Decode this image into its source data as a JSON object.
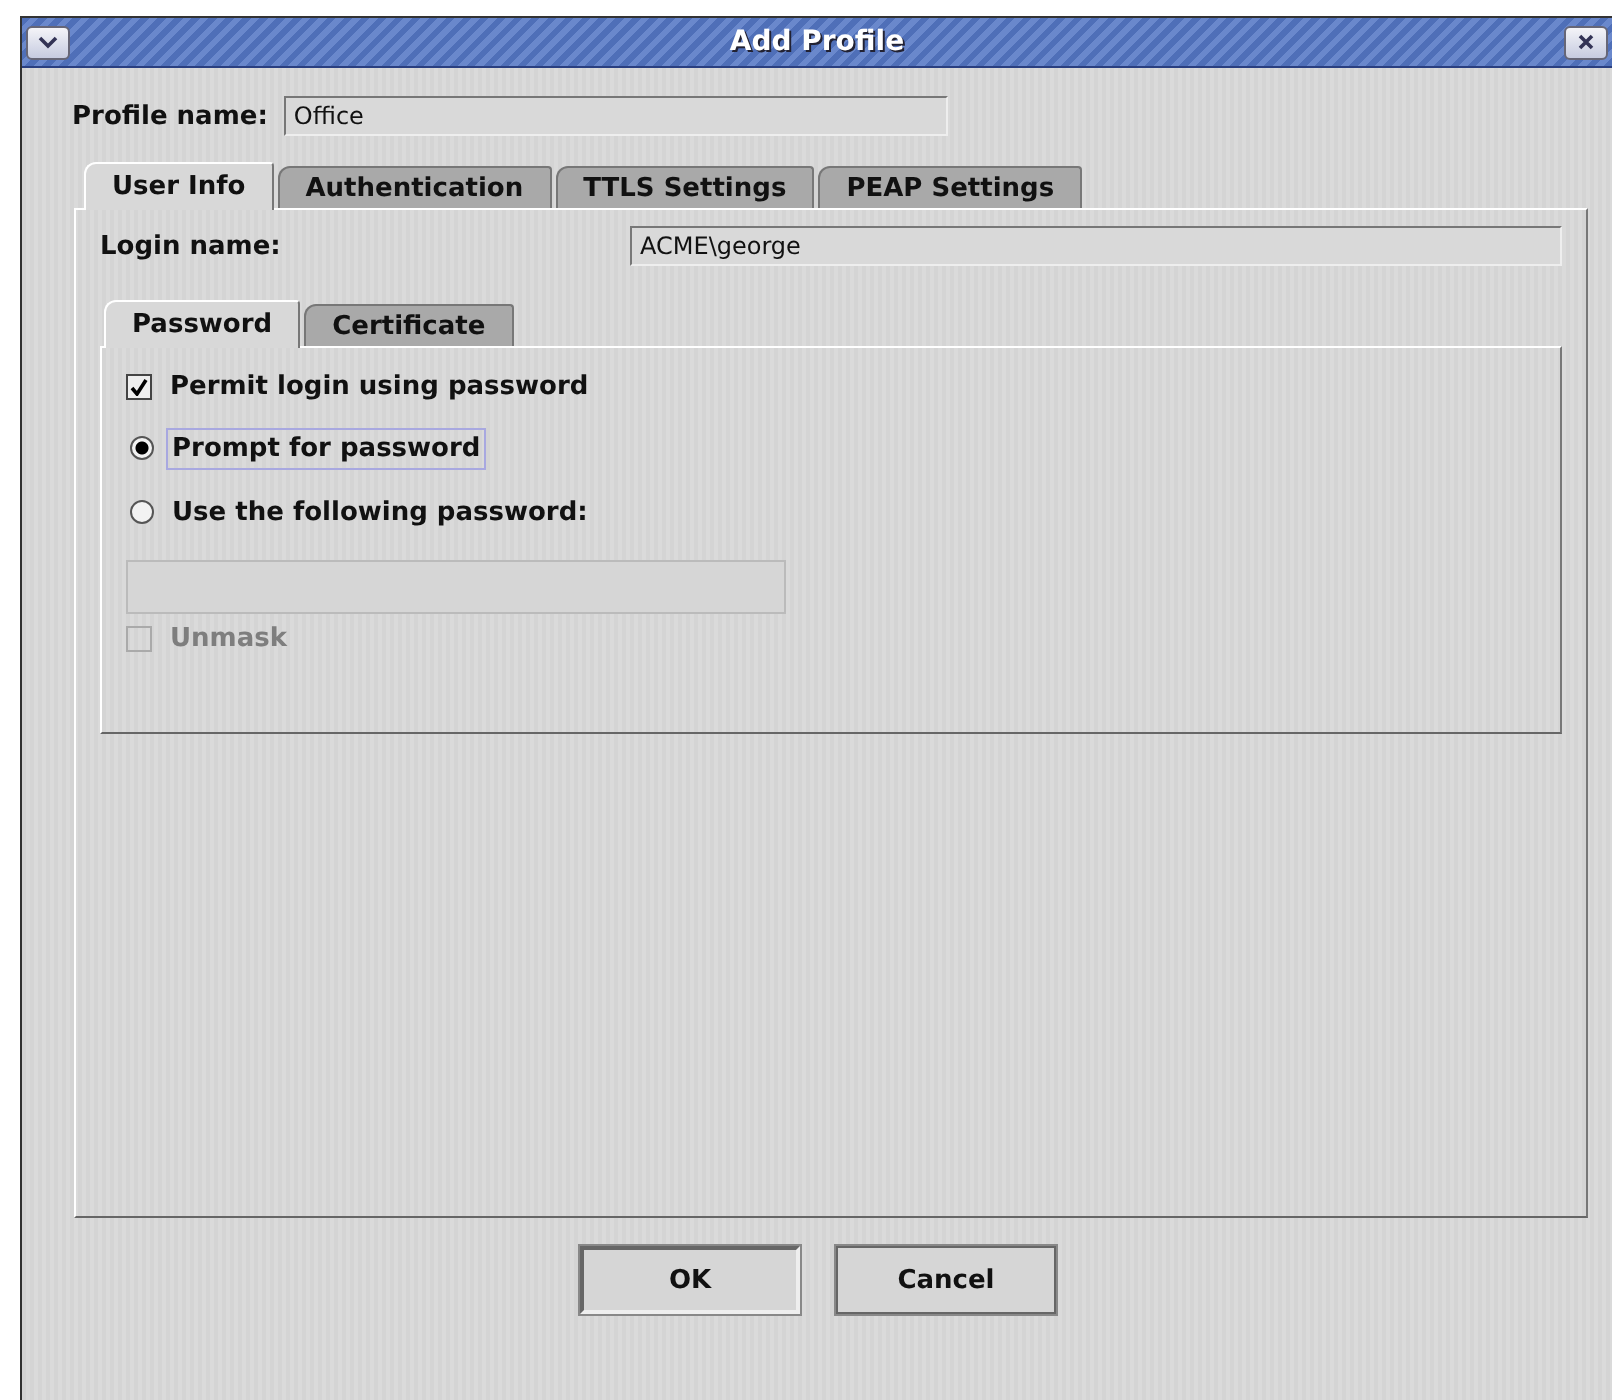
{
  "window": {
    "title": "Add Profile"
  },
  "profile_name": {
    "label": "Profile name:",
    "value": "Office"
  },
  "tabs": [
    {
      "label": "User Info",
      "selected": true
    },
    {
      "label": "Authentication",
      "selected": false
    },
    {
      "label": "TTLS Settings",
      "selected": false
    },
    {
      "label": "PEAP Settings",
      "selected": false
    }
  ],
  "login_name": {
    "label": "Login name:",
    "value": "ACME\\george"
  },
  "inner_tabs": [
    {
      "label": "Password",
      "selected": true
    },
    {
      "label": "Certificate",
      "selected": false
    }
  ],
  "permit_login": {
    "label": "Permit login using password",
    "checked": true
  },
  "password_options": [
    {
      "label": "Prompt for password",
      "selected": true,
      "focused": true
    },
    {
      "label": "Use the following password:",
      "selected": false,
      "focused": false
    }
  ],
  "password_field": {
    "disabled": true
  },
  "unmask": {
    "label": "Unmask",
    "checked": false,
    "disabled": true
  },
  "buttons": [
    {
      "label": "OK",
      "default": true
    },
    {
      "label": "Cancel",
      "default": false
    }
  ]
}
